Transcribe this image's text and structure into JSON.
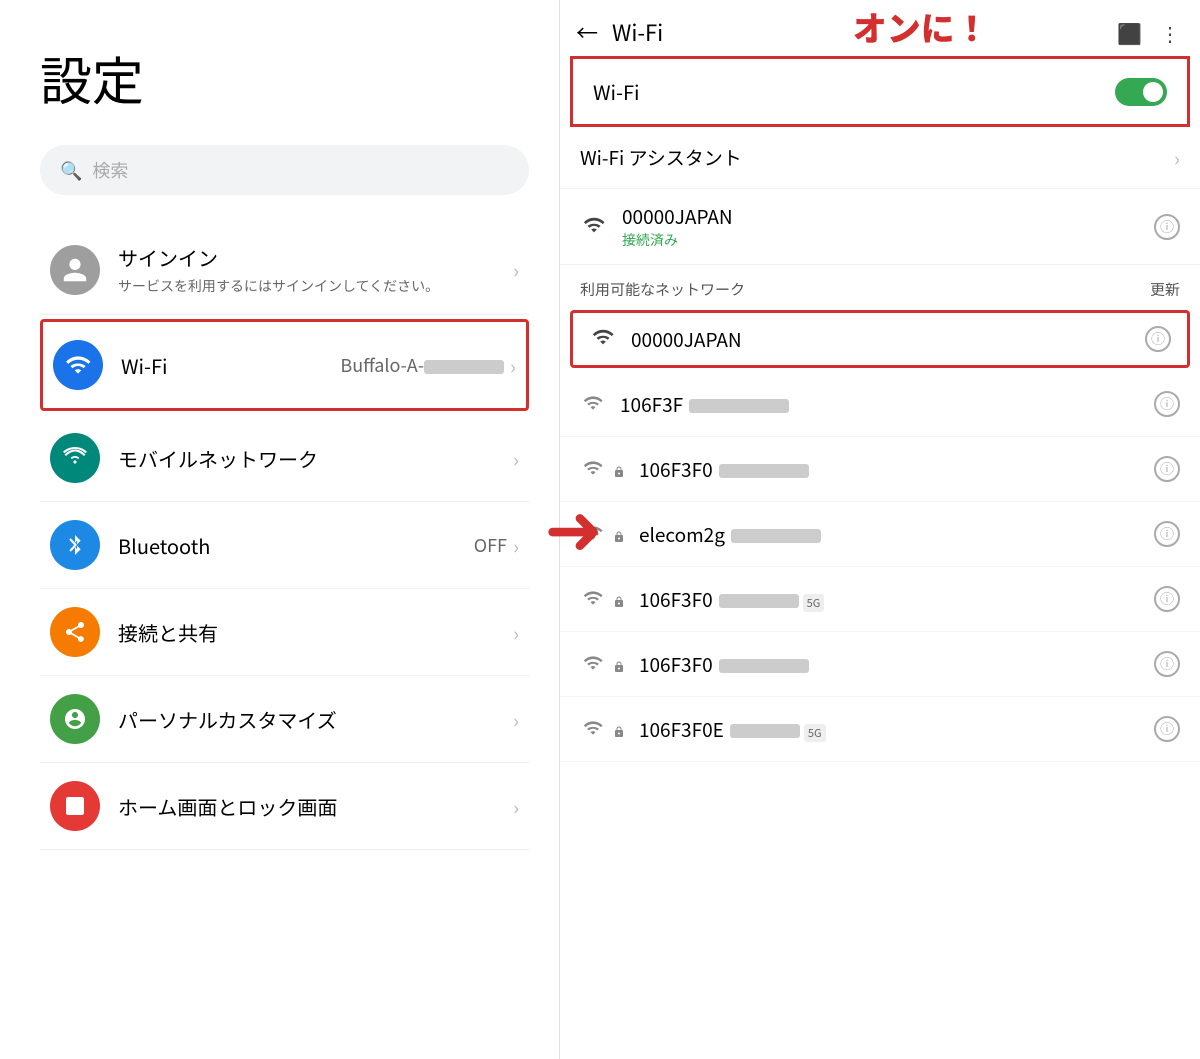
{
  "left": {
    "title": "設定",
    "search": {
      "placeholder": "検索"
    },
    "items": [
      {
        "id": "signin",
        "label": "サインイン",
        "sublabel": "サービスを利用するにはサインインしてください。",
        "icon_type": "avatar",
        "icon_color": "gray-avatar",
        "has_chevron": true,
        "highlighted": false
      },
      {
        "id": "wifi",
        "label": "Wi-Fi",
        "value": "Buffalo-A-",
        "icon_symbol": "wifi",
        "icon_color": "blue",
        "has_chevron": true,
        "highlighted": true
      },
      {
        "id": "mobile",
        "label": "モバイルネットワーク",
        "icon_symbol": "signal",
        "icon_color": "green-teal",
        "has_chevron": true,
        "highlighted": false
      },
      {
        "id": "bluetooth",
        "label": "Bluetooth",
        "value": "OFF",
        "icon_symbol": "bluetooth",
        "icon_color": "blue-bt",
        "has_chevron": true,
        "highlighted": false
      },
      {
        "id": "connection",
        "label": "接続と共有",
        "icon_symbol": "share",
        "icon_color": "orange",
        "has_chevron": true,
        "highlighted": false
      },
      {
        "id": "personal",
        "label": "パーソナルカスタマイズ",
        "icon_symbol": "person",
        "icon_color": "green",
        "has_chevron": true,
        "highlighted": false
      },
      {
        "id": "homescreen",
        "label": "ホーム画面とロック画面",
        "icon_symbol": "image",
        "icon_color": "red",
        "has_chevron": true,
        "highlighted": false
      }
    ]
  },
  "right": {
    "header": {
      "back_label": "←",
      "title": "Wi-Fi",
      "annotation": "オンに！"
    },
    "wifi_toggle": {
      "label": "Wi-Fi",
      "state": "on"
    },
    "connected_network": {
      "name": "00000JAPAN",
      "status": "接続済み"
    },
    "available_section": {
      "title": "利用可能なネットワーク",
      "refresh": "更新"
    },
    "highlighted_network": {
      "name": "00000JAPAN"
    },
    "networks": [
      {
        "name": "106F3F",
        "redacted": true,
        "locked": false,
        "badge": ""
      },
      {
        "name": "106F3F0",
        "redacted": true,
        "locked": true,
        "badge": ""
      },
      {
        "name": "elecom2g",
        "redacted": true,
        "locked": true,
        "badge": ""
      },
      {
        "name": "106F3F0",
        "redacted": true,
        "locked": true,
        "badge": "5G"
      },
      {
        "name": "106F3F0",
        "redacted": true,
        "locked": true,
        "badge": ""
      },
      {
        "name": "106F3F0E",
        "redacted": true,
        "locked": true,
        "badge": "5G"
      }
    ]
  }
}
